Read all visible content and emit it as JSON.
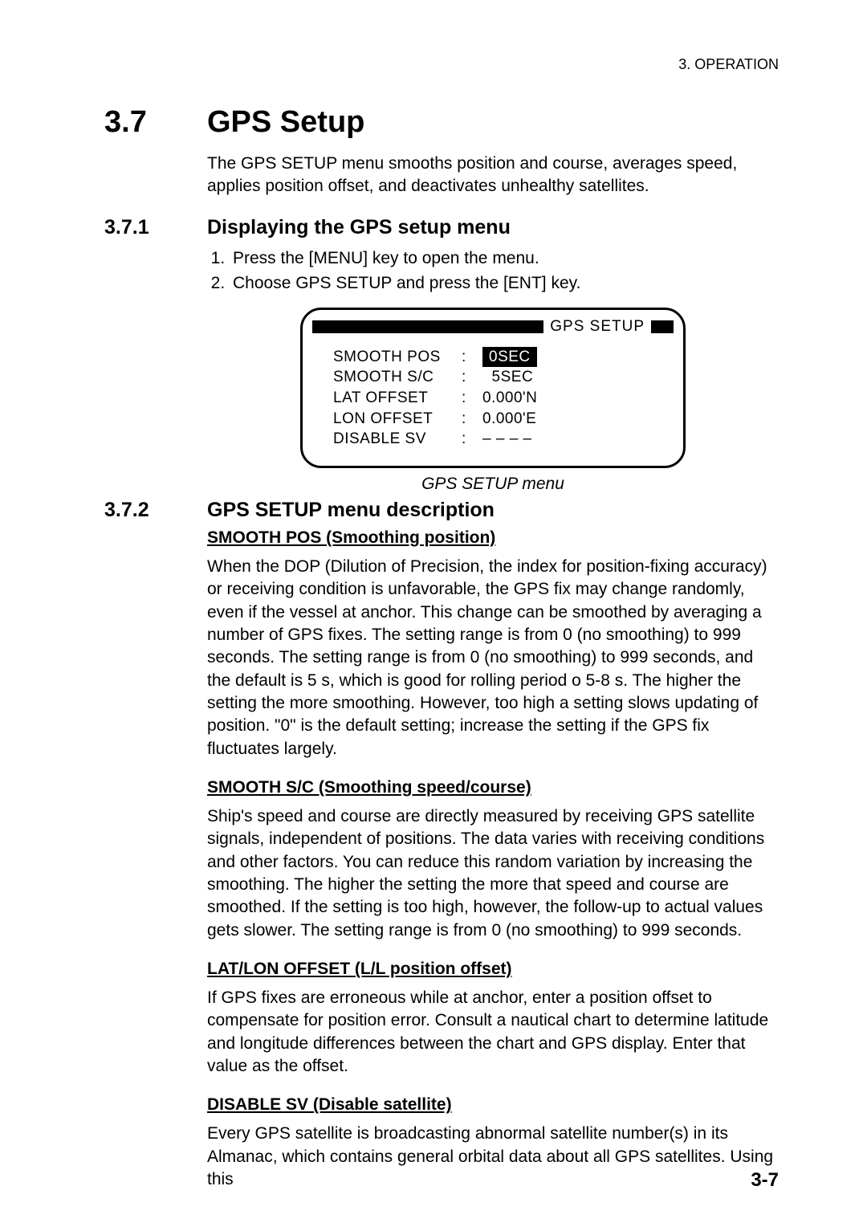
{
  "header": {
    "running": "3. OPERATION"
  },
  "section": {
    "num": "3.7",
    "title": "GPS Setup"
  },
  "intro": "The GPS SETUP menu smooths position and course, averages speed, applies position offset, and deactivates unhealthy satellites.",
  "sub1": {
    "num": "3.7.1",
    "title": "Displaying the GPS setup menu",
    "steps": [
      "Press the [MENU] key to open the menu.",
      "Choose GPS SETUP and press the [ENT] key."
    ]
  },
  "screen": {
    "title": "GPS SETUP",
    "rows": {
      "r0": {
        "label": "SMOOTH POS",
        "value": "0SEC"
      },
      "r1": {
        "label": "SMOOTH S/C",
        "value": "  5SEC"
      },
      "r2": {
        "label": "LAT OFFSET",
        "value": "0.000'N"
      },
      "r3": {
        "label": "LON OFFSET",
        "value": "0.000'E"
      },
      "r4": {
        "label": "DISABLE SV",
        "value": "– –  – –"
      }
    },
    "caption": "GPS SETUP menu"
  },
  "sub2": {
    "num": "3.7.2",
    "title": "GPS SETUP menu description",
    "p1": {
      "head": "SMOOTH POS (Smoothing position)",
      "body": "When the DOP (Dilution of Precision, the index for position-fixing accuracy) or receiving condition is unfavorable, the GPS fix may change randomly, even if the vessel at anchor. This change can be smoothed by averaging a number of GPS fixes. The setting range is from 0 (no smoothing) to 999 seconds. The setting range is from 0 (no smoothing) to 999 seconds, and the default is 5 s, which is good for rolling period o 5-8 s. The higher the setting the more smoothing. However, too high a setting slows updating of position. \"0\" is the default setting; increase the setting if the GPS fix fluctuates largely."
    },
    "p2": {
      "head": "SMOOTH S/C (Smoothing speed/course)",
      "body": "Ship's speed and course are directly measured by receiving GPS satellite signals, independent of positions. The data varies with receiving conditions and other factors. You can reduce this random variation by increasing the smoothing. The higher the setting the more that speed and course are smoothed. If the setting is too high, however, the follow-up to actual values gets slower. The setting range is from 0 (no smoothing) to 999 seconds."
    },
    "p3": {
      "head": "LAT/LON OFFSET (L/L position offset)",
      "body": "If GPS fixes are erroneous while at anchor, enter a position offset to compensate for position error. Consult a nautical chart to determine latitude and longitude differences between the chart and GPS display. Enter that value as the offset."
    },
    "p4": {
      "head": "DISABLE SV (Disable satellite)",
      "body": "Every GPS satellite is broadcasting abnormal satellite number(s) in its Almanac, which contains general orbital data about all GPS satellites. Using this"
    }
  },
  "pagenum": "3-7"
}
